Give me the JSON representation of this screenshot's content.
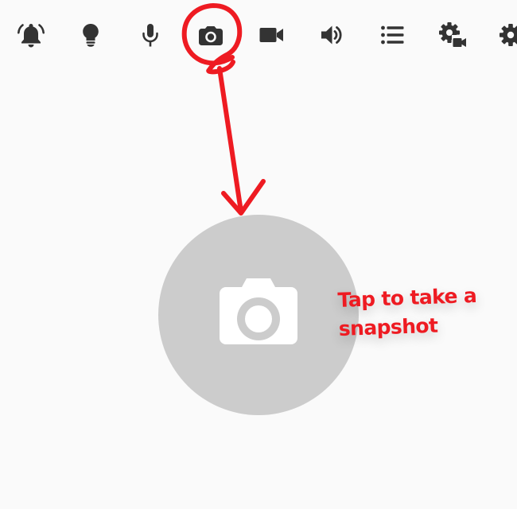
{
  "toolbar": {
    "items": [
      {
        "icon": "alarm-bell-icon",
        "active": false
      },
      {
        "icon": "lightbulb-icon",
        "active": false
      },
      {
        "icon": "microphone-icon",
        "active": false
      },
      {
        "icon": "camera-icon",
        "active": true
      },
      {
        "icon": "video-camera-icon",
        "active": false
      },
      {
        "icon": "volume-icon",
        "active": false
      },
      {
        "icon": "list-icon",
        "active": false
      },
      {
        "icon": "camera-settings-icon",
        "active": false
      },
      {
        "icon": "gear-icon",
        "active": false
      }
    ]
  },
  "main": {
    "snapshot_button": {
      "icon": "camera-icon"
    }
  },
  "annotation": {
    "callout_line1": "Tap to take a",
    "callout_line2": "snapshot"
  },
  "colors": {
    "background": "#fafafa",
    "icon": "#333333",
    "button_circle": "#cccccc",
    "button_icon": "#ffffff",
    "annotation": "#ee1b22"
  }
}
